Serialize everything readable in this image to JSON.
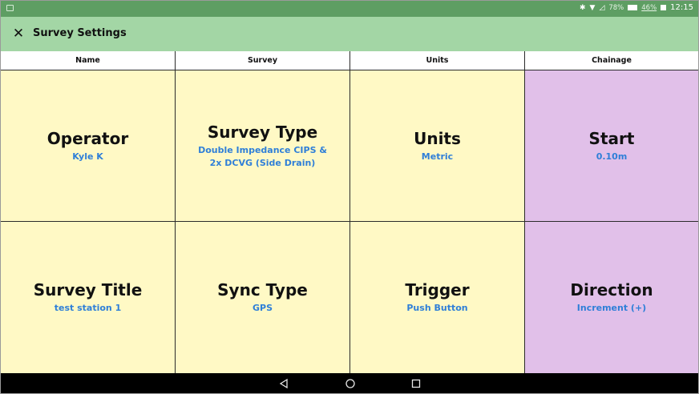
{
  "status_bar": {
    "icons": [
      "screenshot-icon",
      "bluetooth-icon",
      "wifi-icon",
      "signal-icon",
      "battery-icon"
    ],
    "battery_percent": "78%",
    "battery_percent_2": "46%",
    "time": "12:15"
  },
  "toolbar": {
    "close_icon": "close-icon",
    "title": "Survey Settings",
    "background": "#a3d6a5"
  },
  "columns": {
    "name": "Name",
    "survey": "Survey",
    "units": "Units",
    "chainage": "Chainage"
  },
  "tiles": {
    "operator": {
      "label": "Operator",
      "value": "Kyle K"
    },
    "survey_type": {
      "label": "Survey Type",
      "value": "Double Impedance CIPS & 2x DCVG (Side Drain)"
    },
    "units": {
      "label": "Units",
      "value": "Metric"
    },
    "start": {
      "label": "Start",
      "value": "0.10m"
    },
    "survey_title": {
      "label": "Survey Title",
      "value": "test station 1"
    },
    "sync_type": {
      "label": "Sync Type",
      "value": "GPS"
    },
    "trigger": {
      "label": "Trigger",
      "value": "Push Button"
    },
    "direction": {
      "label": "Direction",
      "value": "Increment (+)"
    }
  },
  "colors": {
    "tile_yellow": "#fff9c5",
    "tile_purple": "#e1c0e9",
    "value_blue": "#2f7fd8",
    "status_bar": "#5e9e63"
  },
  "nav_bar": {
    "icons": [
      "back-icon",
      "home-icon",
      "recent-apps-icon"
    ]
  }
}
